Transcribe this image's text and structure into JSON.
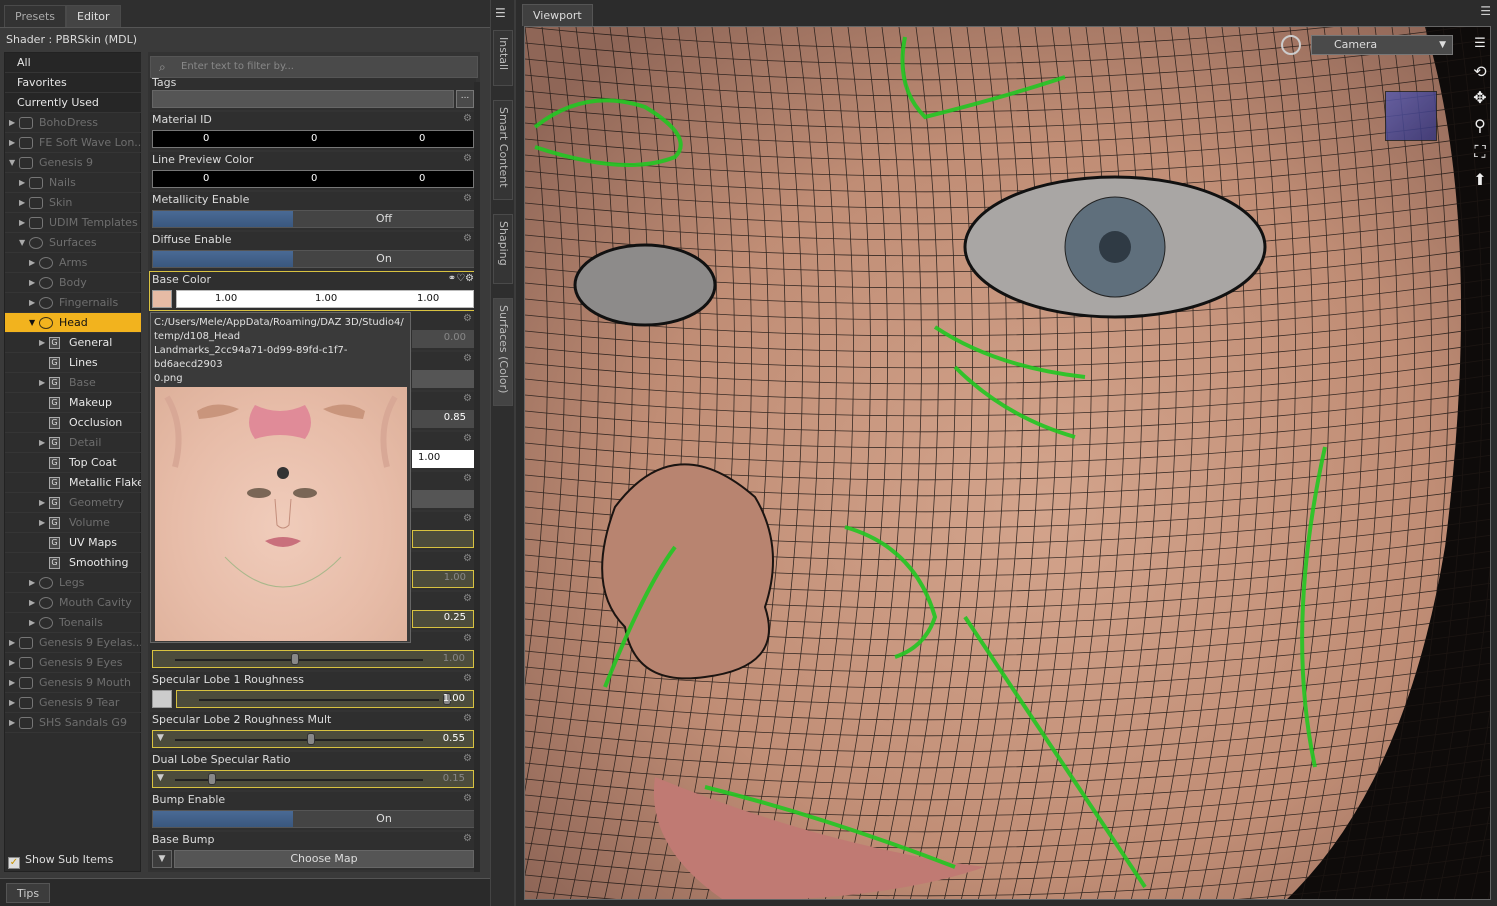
{
  "tabs": {
    "presets": "Presets",
    "editor": "Editor"
  },
  "shader_label": "Shader :  PBRSkin (MDL)",
  "tree": {
    "top": [
      "All",
      "Favorites",
      "Currently Used"
    ],
    "items": [
      {
        "label": "BohoDress",
        "indent": 0,
        "state": "dim",
        "arrow": "▶",
        "icon": "figure"
      },
      {
        "label": "FE Soft Wave Lon...",
        "indent": 0,
        "state": "dim",
        "arrow": "▶",
        "icon": "figure"
      },
      {
        "label": "Genesis 9",
        "indent": 0,
        "state": "dim",
        "arrow": "▼",
        "icon": "figure"
      },
      {
        "label": "Nails",
        "indent": 1,
        "state": "dim",
        "arrow": "▶",
        "icon": "group"
      },
      {
        "label": "Skin",
        "indent": 1,
        "state": "dim",
        "arrow": "▶",
        "icon": "group"
      },
      {
        "label": "UDIM Templates",
        "indent": 1,
        "state": "dim",
        "arrow": "▶",
        "icon": "group"
      },
      {
        "label": "Surfaces",
        "indent": 1,
        "state": "dim",
        "arrow": "▼",
        "icon": "surface"
      },
      {
        "label": "Arms",
        "indent": 2,
        "state": "dim",
        "arrow": "▶",
        "icon": "surface"
      },
      {
        "label": "Body",
        "indent": 2,
        "state": "dim",
        "arrow": "▶",
        "icon": "surface"
      },
      {
        "label": "Fingernails",
        "indent": 2,
        "state": "dim",
        "arrow": "▶",
        "icon": "surface"
      },
      {
        "label": "Head",
        "indent": 2,
        "state": "sel",
        "arrow": "▼",
        "icon": "surface"
      },
      {
        "label": "General",
        "indent": 3,
        "state": "bright",
        "arrow": "▶",
        "icon": "g"
      },
      {
        "label": "Lines",
        "indent": 3,
        "state": "bright",
        "arrow": "",
        "icon": "g"
      },
      {
        "label": "Base",
        "indent": 3,
        "state": "dim",
        "arrow": "▶",
        "icon": "g"
      },
      {
        "label": "Makeup",
        "indent": 3,
        "state": "bright",
        "arrow": "",
        "icon": "g"
      },
      {
        "label": "Occlusion",
        "indent": 3,
        "state": "bright",
        "arrow": "",
        "icon": "g"
      },
      {
        "label": "Detail",
        "indent": 3,
        "state": "dim",
        "arrow": "▶",
        "icon": "g"
      },
      {
        "label": "Top Coat",
        "indent": 3,
        "state": "bright",
        "arrow": "",
        "icon": "g"
      },
      {
        "label": "Metallic Flakes",
        "indent": 3,
        "state": "bright",
        "arrow": "",
        "icon": "g"
      },
      {
        "label": "Geometry",
        "indent": 3,
        "state": "dim",
        "arrow": "▶",
        "icon": "g"
      },
      {
        "label": "Volume",
        "indent": 3,
        "state": "dim",
        "arrow": "▶",
        "icon": "g"
      },
      {
        "label": "UV Maps",
        "indent": 3,
        "state": "bright",
        "arrow": "",
        "icon": "g"
      },
      {
        "label": "Smoothing",
        "indent": 3,
        "state": "bright",
        "arrow": "",
        "icon": "g"
      },
      {
        "label": "Legs",
        "indent": 2,
        "state": "dim",
        "arrow": "▶",
        "icon": "surface"
      },
      {
        "label": "Mouth Cavity",
        "indent": 2,
        "state": "dim",
        "arrow": "▶",
        "icon": "surface"
      },
      {
        "label": "Toenails",
        "indent": 2,
        "state": "dim",
        "arrow": "▶",
        "icon": "surface"
      },
      {
        "label": "Genesis 9 Eyelas...",
        "indent": 0,
        "state": "dim",
        "arrow": "▶",
        "icon": "figure"
      },
      {
        "label": "Genesis 9 Eyes",
        "indent": 0,
        "state": "dim",
        "arrow": "▶",
        "icon": "figure"
      },
      {
        "label": "Genesis 9 Mouth",
        "indent": 0,
        "state": "dim",
        "arrow": "▶",
        "icon": "figure"
      },
      {
        "label": "Genesis 9 Tear",
        "indent": 0,
        "state": "dim",
        "arrow": "▶",
        "icon": "figure"
      },
      {
        "label": "SHS Sandals G9",
        "indent": 0,
        "state": "dim",
        "arrow": "▶",
        "icon": "figure"
      }
    ]
  },
  "show_sub_items": "Show Sub Items",
  "filter_placeholder": "Enter text to filter by...",
  "props": {
    "tags": "Tags",
    "material_id": {
      "label": "Material ID",
      "v": [
        "0",
        "0",
        "0"
      ]
    },
    "line_preview": {
      "label": "Line Preview Color",
      "v": [
        "0",
        "0",
        "0"
      ]
    },
    "metallicity": {
      "label": "Metallicity Enable",
      "value": "Off"
    },
    "diffuse": {
      "label": "Diffuse Enable",
      "value": "On"
    },
    "base_color": {
      "label": "Base Color",
      "v": [
        "1.00",
        "1.00",
        "1.00"
      ]
    },
    "partial_values": [
      "0.00",
      "0.85",
      "1.00",
      "1.00",
      "0.25",
      "1.00"
    ],
    "spec1": {
      "label": "Specular Lobe 1 Roughness",
      "value": "1.00",
      "level": 1.0
    },
    "spec2": {
      "label": "Specular Lobe 2 Roughness Mult",
      "value": "0.55",
      "level": 0.55
    },
    "dual": {
      "label": "Dual Lobe Specular Ratio",
      "value": "0.15",
      "level": 0.15
    },
    "bump": {
      "label": "Bump Enable",
      "value": "On"
    },
    "base_bump": {
      "label": "Base Bump",
      "value": "Choose Map"
    }
  },
  "tooltip": {
    "line1": "C:/Users/Mele/AppData/Roaming/DAZ 3D/Studio4/",
    "line2": "temp/d108_Head",
    "line3": "Landmarks_2cc94a71-0d99-89fd-c1f7-",
    "line4": "bd6aecd2903",
    "line5": "0.png"
  },
  "tips_label": "Tips",
  "side_tabs": [
    "Install",
    "Smart Content",
    "Shaping",
    "Surfaces (Color)"
  ],
  "viewport": {
    "tab": "Viewport",
    "camera": "Camera"
  },
  "colors": {
    "accent": "#f2b31e",
    "mesh_line": "#1a1a1a",
    "landmark": "#22c722",
    "skin": "#c99a82"
  }
}
